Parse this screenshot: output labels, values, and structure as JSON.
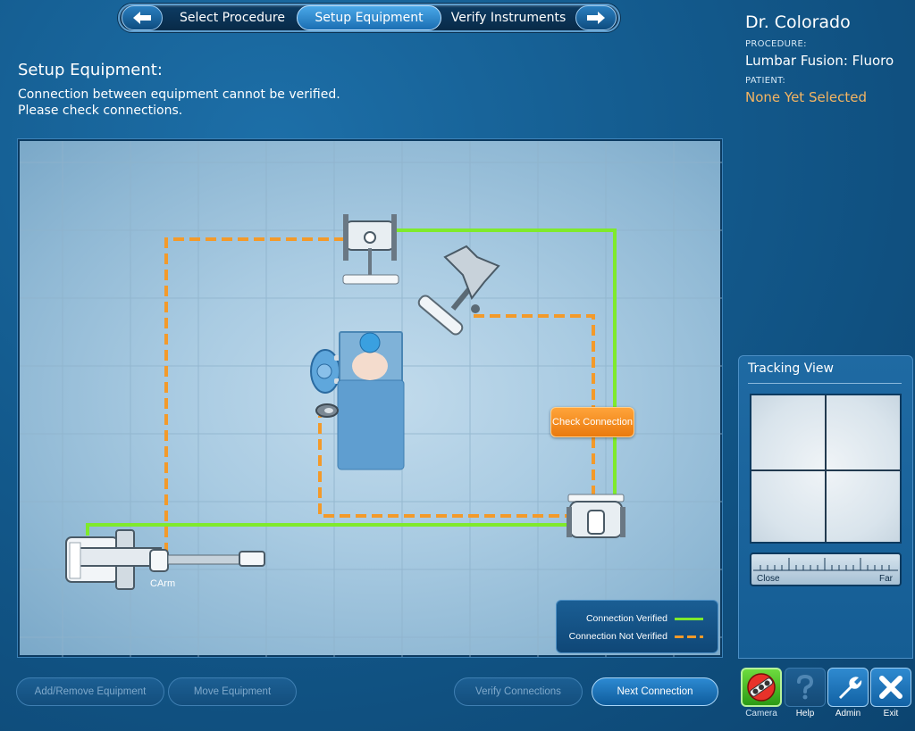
{
  "wizard": {
    "steps": [
      "Select Procedure",
      "Setup Equipment",
      "Verify Instruments"
    ],
    "active_step": "Setup Equipment"
  },
  "header": {
    "doctor": "Dr. Colorado",
    "procedure_label": "PROCEDURE:",
    "procedure_value": "Lumbar Fusion: Fluoro",
    "patient_label": "PATIENT:",
    "patient_value": "None Yet Selected"
  },
  "page": {
    "title": "Setup Equipment:",
    "message_line1": "Connection between equipment cannot be verified.",
    "message_line2": "Please check connections."
  },
  "map": {
    "check_connection": "Check Connection",
    "carm_label": "CArm",
    "legend": {
      "verified": "Connection Verified",
      "not_verified": "Connection Not Verified"
    }
  },
  "buttons": {
    "add_remove": "Add/Remove Equipment",
    "move": "Move Equipment",
    "verify": "Verify Connections",
    "next": "Next Connection"
  },
  "tracking": {
    "title": "Tracking View",
    "close": "Close",
    "far": "Far"
  },
  "toolbar": {
    "camera": "Camera",
    "help": "Help",
    "admin": "Admin",
    "exit": "Exit"
  },
  "colors": {
    "verified": "#7fea2c",
    "not_verified": "#f39a2a",
    "accent": "#2d8ad2",
    "patient_text": "#f5b562"
  }
}
